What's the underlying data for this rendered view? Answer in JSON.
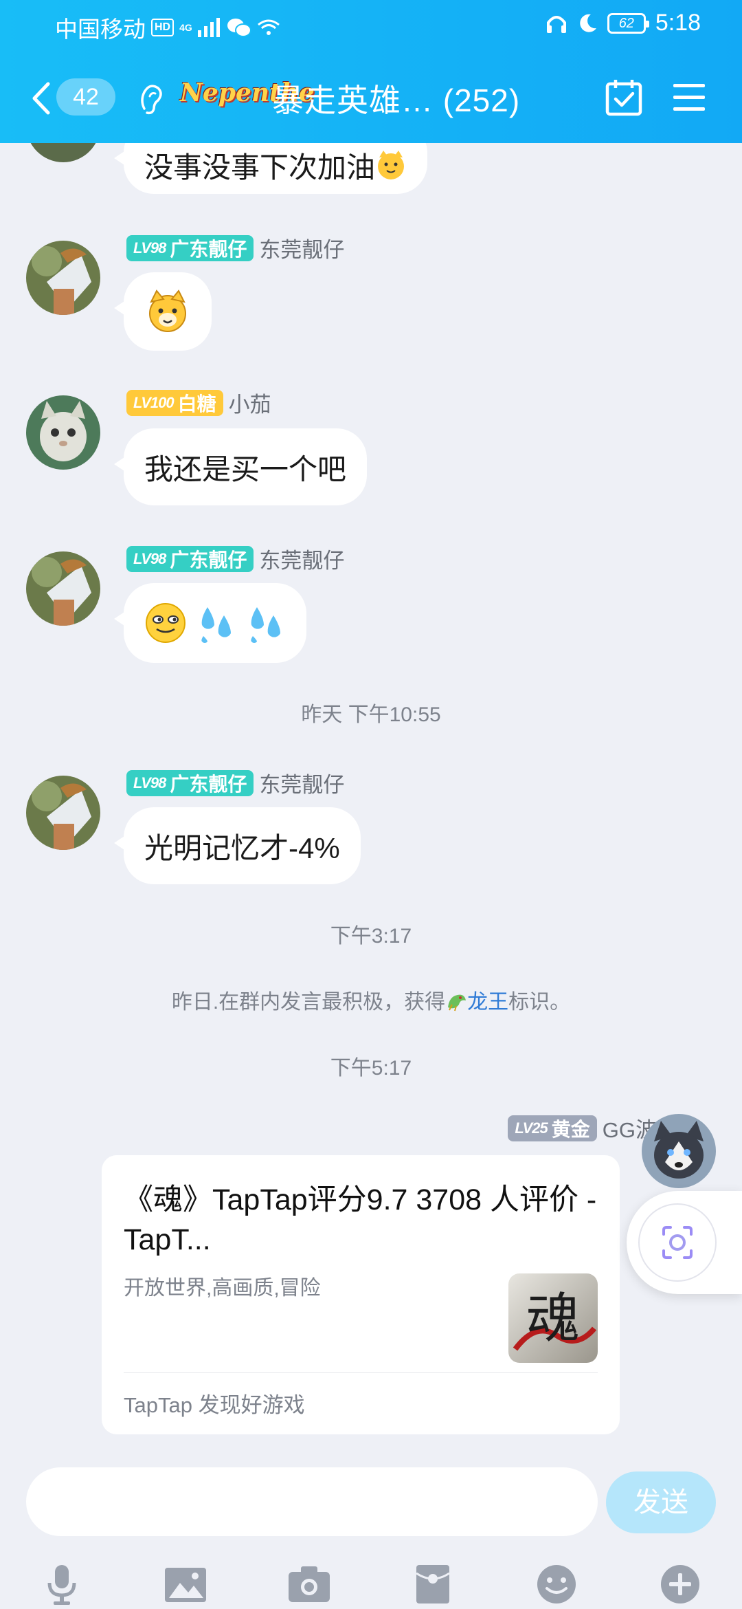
{
  "status_bar": {
    "carrier": "中国移动",
    "hd": "HD",
    "network": "4G",
    "battery": "62",
    "time": "5:18"
  },
  "header": {
    "unread_count": "42",
    "group_tag": "Nepenthe",
    "group_name": "暴走英雄…  (252)",
    "icons": [
      "back-icon",
      "ear-icon",
      "calendar-check-icon",
      "menu-icon"
    ]
  },
  "messages": [
    {
      "id": "m0",
      "type": "text",
      "text": "没事没事下次加油",
      "emoji": "dog-face-emoji"
    },
    {
      "id": "m1",
      "type": "sticker",
      "level": "LV98",
      "title": "广东靓仔",
      "nickname": "东莞靓仔",
      "emoji": "yellow-dog-emoji"
    },
    {
      "id": "m2",
      "type": "text",
      "level": "LV100",
      "title": "白糖",
      "nickname": "小茄",
      "text": "我还是买一个吧"
    },
    {
      "id": "m3",
      "type": "emoji",
      "level": "LV98",
      "title": "广东靓仔",
      "nickname": "东莞靓仔",
      "emoji": [
        "smirk-face-emoji",
        "sweat-drops-emoji",
        "sweat-drops-emoji"
      ]
    },
    {
      "id": "m4",
      "type": "text",
      "level": "LV98",
      "title": "广东靓仔",
      "nickname": "东莞靓仔",
      "text": "光明记忆才-4%"
    }
  ],
  "time_separators": [
    "昨天 下午10:55",
    "下午3:17",
    "下午5:17"
  ],
  "system_notice": {
    "before": "昨日.在群内发言最积极，获得",
    "highlight": "龙王",
    "after": "标识。"
  },
  "share_card": {
    "level": "LV25",
    "title_badge": "黄金",
    "nickname": "GG波",
    "title": "《魂》TapTap评分9.7 3708 人评价 - TapT...",
    "subtitle": "开放世界,高画质,冒险",
    "thumb_text": "魂",
    "source": "TapTap 发现好游戏"
  },
  "input": {
    "placeholder": "",
    "send_label": "发送"
  },
  "toolbar": [
    "microphone-icon",
    "image-icon",
    "camera-icon",
    "red-packet-icon",
    "emoji-icon",
    "plus-icon"
  ],
  "colors": {
    "header": "#18bdf7",
    "bg": "#eef0f6",
    "teal_badge": "#35cfc4",
    "gold_badge": "#ffc93a",
    "gray_badge": "#9ea6b8",
    "send_disabled": "#b5e6fb",
    "highlight": "#2f7bd6"
  }
}
